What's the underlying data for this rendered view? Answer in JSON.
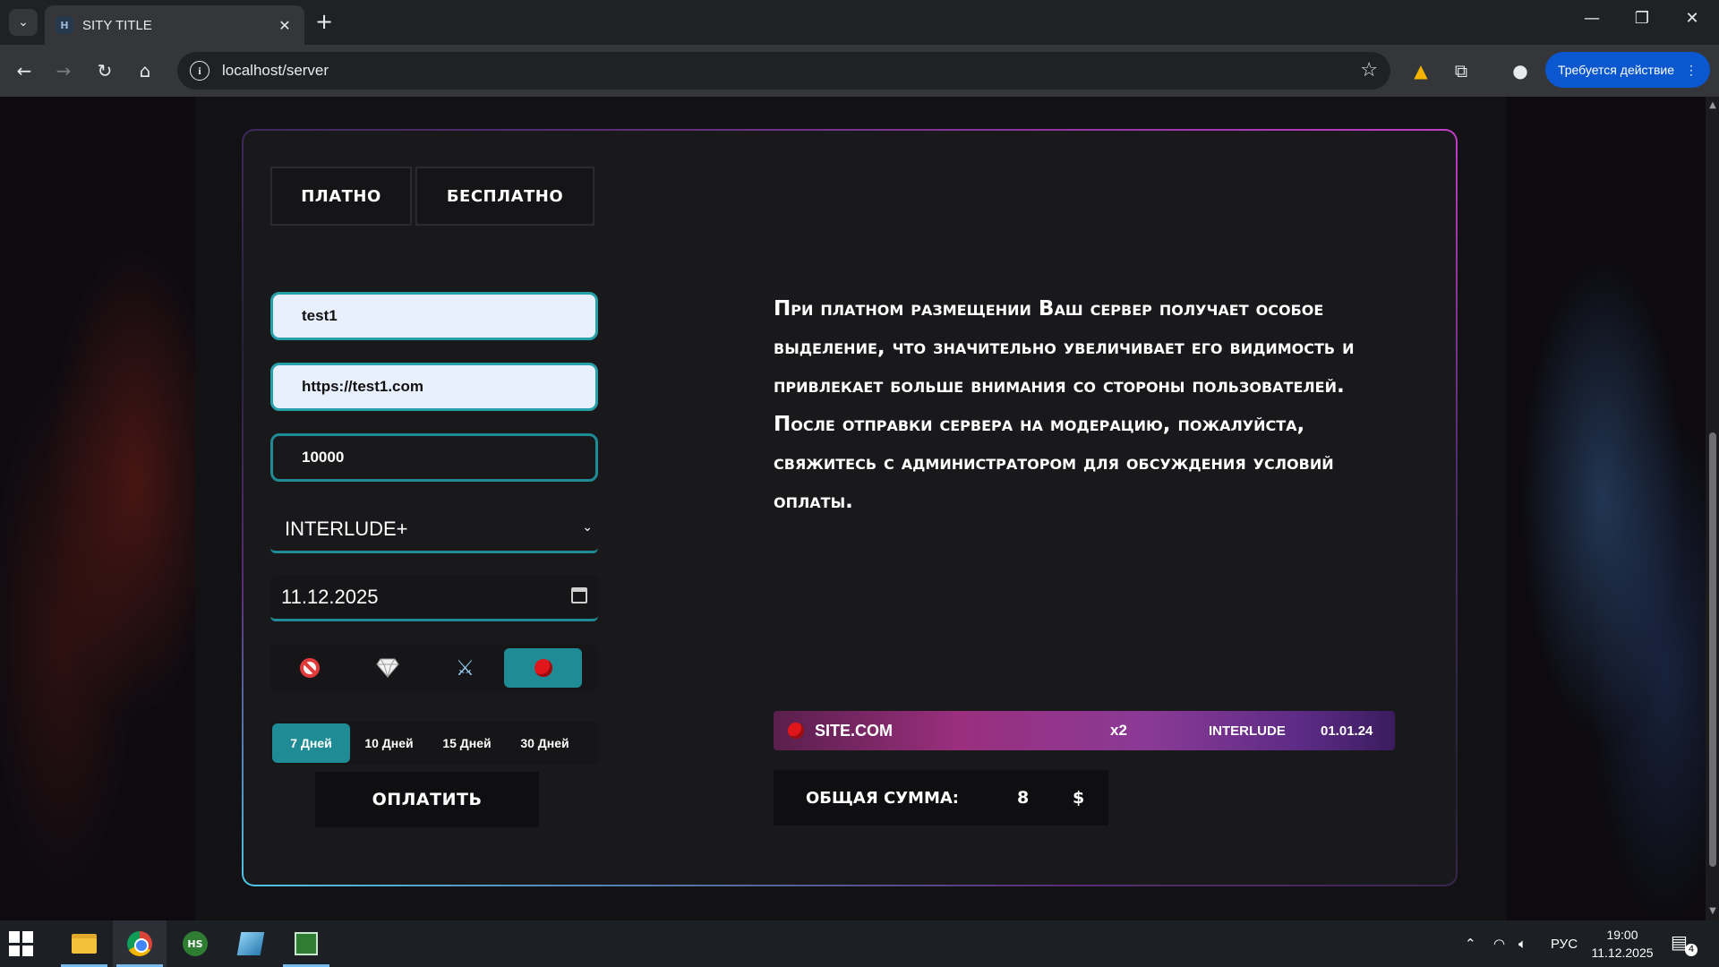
{
  "browser": {
    "tab_title": "SITY TITLE",
    "url": "localhost/server",
    "profile_action": "Требуется действие"
  },
  "page": {
    "type_tabs": [
      "ПЛАТНО",
      "БЕСПЛАТНО"
    ],
    "fields": {
      "name": "test1",
      "site_url": "https://test1.com",
      "rate": "10000"
    },
    "chronicle_select": "INTERLUDE+",
    "date": "11.12.2025",
    "highlight_icons": [
      "ban-icon",
      "diamond-icon",
      "crossed-swords-icon",
      "red-ball-icon"
    ],
    "highlight_selected": 3,
    "days": [
      "7 Дней",
      "10 Дней",
      "15 Дней",
      "30 Дней"
    ],
    "days_selected": 0,
    "pay_button": "ОПЛАТИТЬ",
    "description": "При платном размещении Ваш сервер получает особое выделение, что значительно увеличивает его видимость и привлекает больше внимания со стороны пользователей. После отправки сервера на модерацию, пожалуйста, свяжитесь с администратором для обсуждения условий оплаты.",
    "preview": {
      "site": "SITE.COM",
      "rate": "x2",
      "chronicle": "INTERLUDE",
      "date": "01.01.24"
    },
    "total": {
      "label": "ОБЩАЯ СУММА:",
      "amount": "8",
      "currency": "$"
    }
  },
  "taskbar": {
    "language": "РУС",
    "time": "19:00",
    "date": "11.12.2025",
    "notifications": "4"
  },
  "colors": {
    "accent_teal": "#1f8c95",
    "card_border_pink": "#c33cc9",
    "card_border_cyan": "#4fc6e8"
  }
}
